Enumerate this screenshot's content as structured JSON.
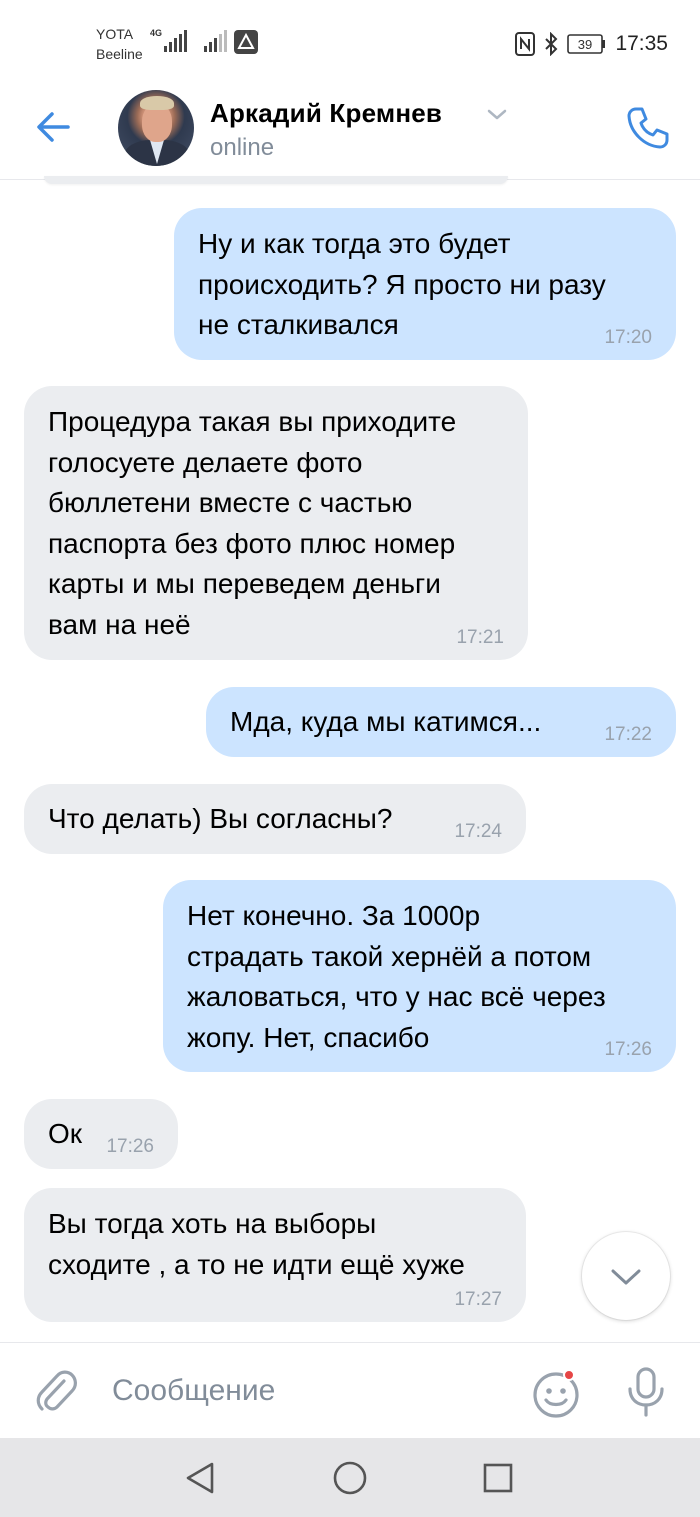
{
  "status_bar": {
    "carrier_1": "YOTA",
    "carrier_2": "Beeline",
    "network_type": "4G",
    "battery": "39",
    "time": "17:35"
  },
  "header": {
    "contact_name": "Аркадий Кремнев",
    "status": "online",
    "icons": [
      "back-arrow-icon",
      "chevron-down-icon",
      "phone-icon"
    ]
  },
  "messages": [
    {
      "direction": "out",
      "text": "Ну и как тогда это будет\nпроисходить? Я просто ни разу\nне сталкивался",
      "time": "17:20"
    },
    {
      "direction": "in",
      "text": "Процедура такая вы приходите\nголосуете делаете фото\nбюллетени вместе с частью\nпаспорта без фото плюс номер\nкарты и мы переведем деньги\nвам на неё",
      "time": "17:21"
    },
    {
      "direction": "out",
      "text": "Мда, куда мы катимся...",
      "time": "17:22"
    },
    {
      "direction": "in",
      "text": "Что делать) Вы согласны?",
      "time": "17:24"
    },
    {
      "direction": "out",
      "text": "Нет конечно. За 1000р\nстрадать такой хернёй а потом\nжаловаться, что у нас всё через\nжопу. Нет, спасибо",
      "time": "17:26"
    },
    {
      "direction": "in",
      "text": "Ок",
      "time": "17:26"
    },
    {
      "direction": "in",
      "text": "Вы тогда хоть на выборы\nсходите , а то не идти ещё хуже",
      "time": "17:27"
    }
  ],
  "composer": {
    "placeholder": "Сообщение",
    "icons": [
      "attach-icon",
      "emoji-icon",
      "microphone-icon"
    ]
  },
  "nav_bar": {
    "icons": [
      "nav-back-icon",
      "nav-home-icon",
      "nav-recents-icon"
    ]
  },
  "colors": {
    "accent": "#3f8ae0",
    "outgoing_bubble": "#cce4ff",
    "incoming_bubble": "#ebedf0",
    "secondary_text": "#818c99",
    "time_text": "#99a2ad"
  }
}
